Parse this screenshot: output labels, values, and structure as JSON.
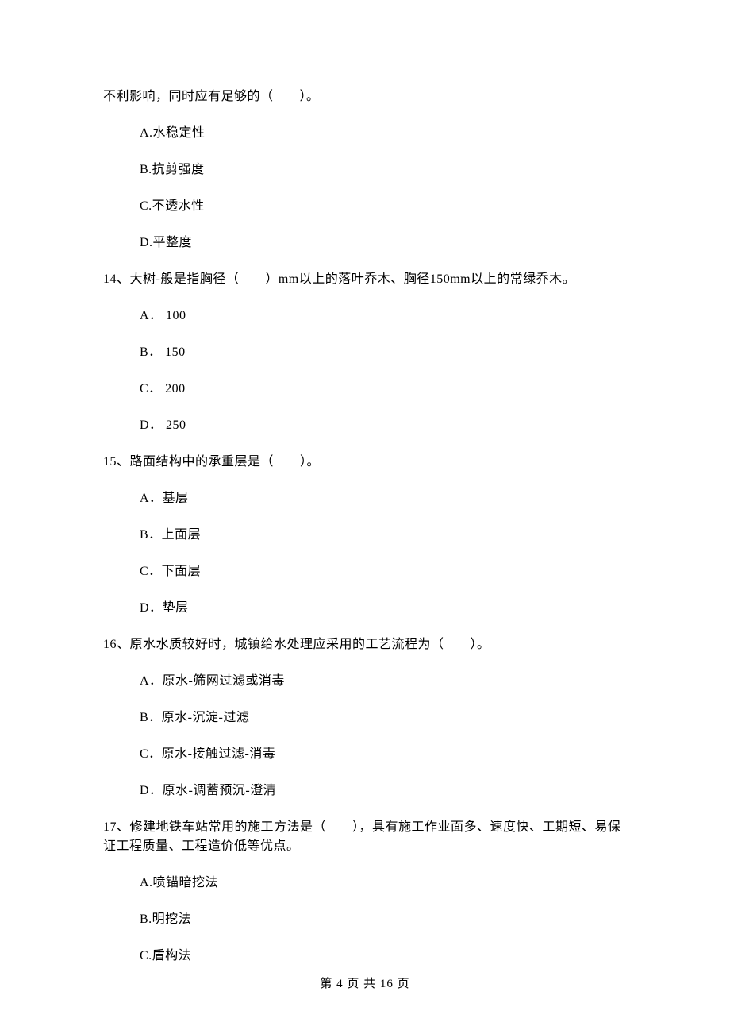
{
  "continuation": "不利影响，同时应有足够的（　　）。",
  "q_cont_options": {
    "a": "A.水稳定性",
    "b": "B.抗剪强度",
    "c": "C.不透水性",
    "d": "D.平整度"
  },
  "q14": {
    "stem": "14、大树-般是指胸径（　　）mm以上的落叶乔木、胸径150mm以上的常绿乔木。",
    "a": "A． 100",
    "b": "B． 150",
    "c": "C． 200",
    "d": "D． 250"
  },
  "q15": {
    "stem": "15、路面结构中的承重层是（　　）。",
    "a": "A．基层",
    "b": "B．上面层",
    "c": "C．下面层",
    "d": "D．垫层"
  },
  "q16": {
    "stem": "16、原水水质较好时，城镇给水处理应采用的工艺流程为（　　）。",
    "a": "A．原水-筛网过滤或消毒",
    "b": "B．原水-沉淀-过滤",
    "c": "C．原水-接触过滤-消毒",
    "d": "D．原水-调蓄预沉-澄清"
  },
  "q17": {
    "stem": "17、修建地铁车站常用的施工方法是（　　），具有施工作业面多、速度快、工期短、易保证工程质量、工程造价低等优点。",
    "a": "A.喷锚暗挖法",
    "b": "B.明挖法",
    "c": "C.盾构法"
  },
  "footer": "第 4 页 共 16 页"
}
